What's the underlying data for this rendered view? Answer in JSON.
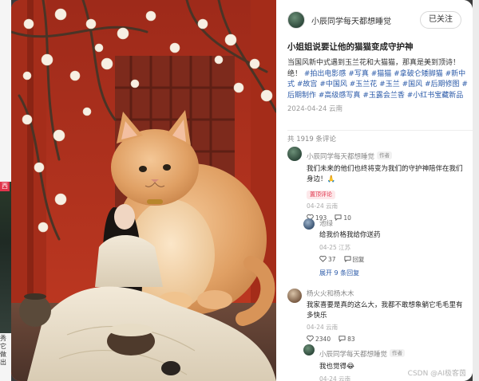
{
  "background": {
    "left_tag": "西",
    "left_text": "秀它 做出"
  },
  "author": {
    "name": "小辰同学每天都想睡觉",
    "follow_label": "已关注"
  },
  "note": {
    "title": "小姐姐说要让他的猫猫变成守护神",
    "desc_text": "当国风新中式遇到玉兰花和大猫猫，那真是美到顶诗！绝！",
    "tags": [
      "#拍出电影感",
      "#写真",
      "#猫猫",
      "#拿破仑矮脚猫",
      "#新中式",
      "#故宫",
      "#中国风",
      "#玉兰花",
      "#玉兰",
      "#国风",
      "#后期修图",
      "#后期制作",
      "#高级感写真",
      "#玉露会兰香",
      "#小红书宝藏新品"
    ],
    "date": "2024-04-24 云南"
  },
  "comments_header": "共 1919 条评论",
  "comments": {
    "c1": {
      "name": "小辰同学每天都想睡觉",
      "badge": "作者",
      "text": "我们未来的他们也终将变为我们的守护神陪伴在我们身边！🙏",
      "pin": "置顶评论",
      "meta": "04-24 云南",
      "likes": "193",
      "replies": "10"
    },
    "r1": {
      "name": "池绿",
      "text": "给我价格我给你送药",
      "meta": "04-25 江苏",
      "likes": "37",
      "reply_label": "回复"
    },
    "expand": "展开 9 条回复",
    "c2": {
      "name": "杨火火和杨木木",
      "text": "我家喜要是真的这么大，我都不敢想象躺它毛毛里有多快乐",
      "meta": "04-24 云南",
      "likes": "2340",
      "replies": "83"
    },
    "r2": {
      "name": "小辰同学每天都想睡觉",
      "badge": "作者",
      "text": "我也觉得😂",
      "meta": "04-24 云南"
    }
  },
  "watermark": "CSDN @AI极客茵",
  "colors": {
    "tag_blue": "#2b5aa8",
    "pin_red": "#e0344b",
    "wall_red": "#b8321f"
  }
}
